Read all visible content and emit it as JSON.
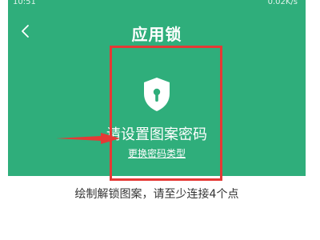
{
  "status_bar": {
    "time": "10:51",
    "network": "0.02K/s"
  },
  "header": {
    "title": "应用锁"
  },
  "lock_setup": {
    "prompt": "请设置图案密码",
    "change_type_link": "更换密码类型",
    "hint": "绘制解锁图案，请至少连接4个点"
  },
  "colors": {
    "header_green": "#2fae7b",
    "annotation_red": "#e53935",
    "text_white": "#ffffff",
    "hint_text": "#333333"
  },
  "icons": {
    "back": "chevron-left-icon",
    "shield": "shield-keyhole-icon"
  }
}
